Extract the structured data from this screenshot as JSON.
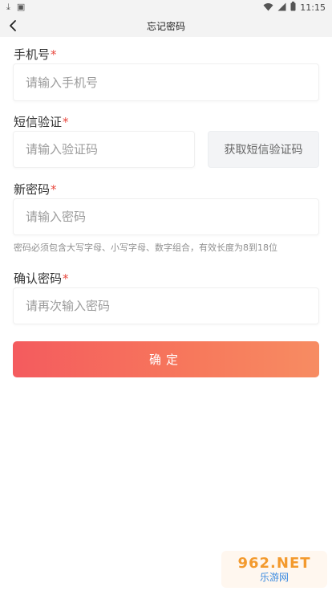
{
  "status_bar": {
    "time": "11:15",
    "icons": [
      "download-icon",
      "image-icon",
      "wifi-icon",
      "signal-icon",
      "battery-icon"
    ]
  },
  "nav": {
    "title": "忘记密码",
    "back_icon": "chevron-left-icon"
  },
  "form": {
    "phone": {
      "label": "手机号",
      "required_mark": "*",
      "placeholder": "请输入手机号",
      "value": ""
    },
    "sms_code": {
      "label": "短信验证",
      "required_mark": "*",
      "placeholder": "请输入验证码",
      "value": "",
      "button_label": "获取短信验证码"
    },
    "new_password": {
      "label": "新密码",
      "required_mark": "*",
      "placeholder": "请输入密码",
      "value": "",
      "hint": "密码必须包含大写字母、小写字母、数字组合，有效长度为8到18位"
    },
    "confirm_password": {
      "label": "确认密码",
      "required_mark": "*",
      "placeholder": "请再次输入密码",
      "value": ""
    },
    "submit_label": "确定"
  },
  "watermark": {
    "top": "962.NET",
    "bottom": "乐游网"
  },
  "colors": {
    "accent_start": "#f45b5e",
    "accent_end": "#f78c62",
    "required": "#e8473d",
    "placeholder": "#9b9b9b"
  }
}
